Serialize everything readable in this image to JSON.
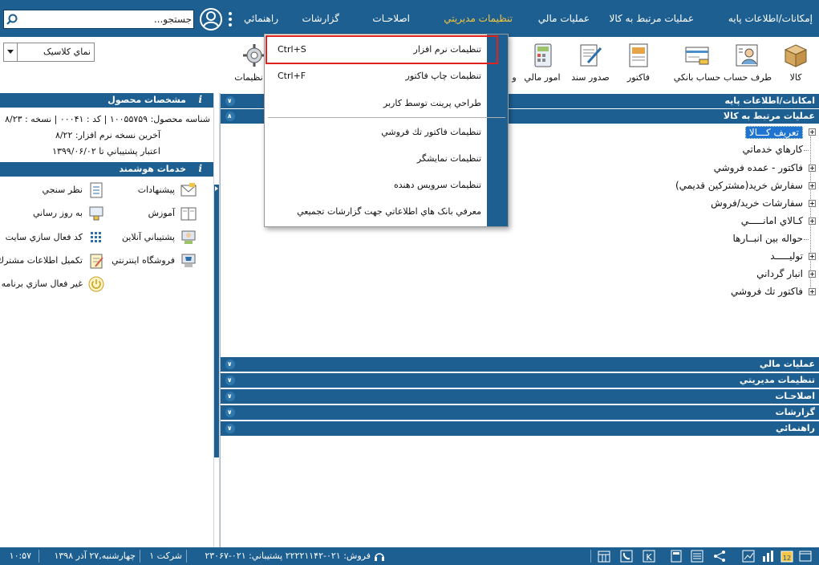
{
  "menu": {
    "items": [
      {
        "label": "إمكانات/اطلاعات پايه"
      },
      {
        "label": "عمليات مرتبط به كالا"
      },
      {
        "label": "عمليات مالي"
      },
      {
        "label": "تنظيمات مديريتي"
      },
      {
        "label": "اصلاحـات"
      },
      {
        "label": "گزارشات"
      },
      {
        "label": "راهنمائي"
      }
    ],
    "active_color": "#f4c542"
  },
  "search": {
    "value": "جستجو..."
  },
  "toolbar": {
    "buttons": [
      {
        "label": "كالا"
      },
      {
        "label": "طرف حساب"
      },
      {
        "label": "حساب بانكي"
      },
      {
        "label": "فاكتور"
      },
      {
        "label": "صدور سند"
      },
      {
        "label": "امور مالي"
      },
      {
        "label": "و"
      },
      {
        "label": "نظيمات"
      }
    ],
    "theme_select": {
      "value": "نماي كلاسيک"
    }
  },
  "product_info": {
    "header": "مشخصات محصول",
    "line1": "شناسه محصول: ۱۰۰۵۵۷۵۹ | كد : ۰۰۰۴۱ | نسخه : ۸/۲۳",
    "line2": "آخرين نسخه نرم افزار: ۸/۲۲",
    "line3": "اعتبار پشتيباني تا ۱۳۹۹/۰۶/۰۲"
  },
  "smart_services": {
    "header": "خدمات هوشمند",
    "items": [
      {
        "label": "پيشنهادات",
        "icon": "envelope-icon"
      },
      {
        "label": "نظر سنجي",
        "icon": "checklist-icon"
      },
      {
        "label": "آموزش",
        "icon": "book-icon"
      },
      {
        "label": "به روز رساني",
        "icon": "update-icon"
      },
      {
        "label": "پشتيباني آنلاين",
        "icon": "support-icon"
      },
      {
        "label": "كد فعال سازي سايت",
        "icon": "keypad-icon"
      },
      {
        "label": "فروشگاه اينترنتي",
        "icon": "shop-icon"
      },
      {
        "label": "تكميل اطلاعات مشترك",
        "icon": "form-icon"
      },
      {
        "label": "غير فعال سازي برنامه",
        "icon": "power-icon"
      }
    ]
  },
  "sections": {
    "top": [
      {
        "title": "امكانات/اطلاعات پايه"
      },
      {
        "title": "عمليات مرتبط به كالا"
      }
    ],
    "bottom": [
      {
        "title": "عمليات مالي"
      },
      {
        "title": "تنظيمات مديريتي"
      },
      {
        "title": "اصلاحـات"
      },
      {
        "title": "گزارشات"
      },
      {
        "title": "راهنمائي"
      }
    ]
  },
  "tree": [
    {
      "label": "تعريف كـــالا",
      "selected": true,
      "expandable": true
    },
    {
      "label": "كارهاي خدماتي",
      "expandable": false
    },
    {
      "label": "فاكتور - عمده فروشي",
      "expandable": true
    },
    {
      "label": "سفارش خريد(مشتركين قديمي)",
      "expandable": true
    },
    {
      "label": "سفارشات خريد/فروش",
      "expandable": true
    },
    {
      "label": "كـالاي امانـــــي",
      "expandable": true
    },
    {
      "label": "حواله بين انبــارها",
      "expandable": false
    },
    {
      "label": "توليـــــد",
      "expandable": true
    },
    {
      "label": "انبار گرداني",
      "expandable": true
    },
    {
      "label": "فاكتور تك فروشي",
      "expandable": true
    }
  ],
  "dropdown": {
    "items": [
      {
        "label": "تنظيمات نرم افزار",
        "shortcut": "Ctrl+S"
      },
      {
        "label": "تنظيمات چاپ فاكتور",
        "shortcut": "Ctrl+F"
      },
      {
        "label": "طراحي پرينت توسط كاربر",
        "shortcut": ""
      },
      {
        "label": "تنظيمات فاكتور تك فروشي",
        "shortcut": ""
      },
      {
        "label": "تنظيمات نمايشگر",
        "shortcut": ""
      },
      {
        "label": "تنظيمات سرويس دهنده",
        "shortcut": ""
      },
      {
        "label": "معرفي بانک هاي اطلاعاتي جهت گزارشات تجميعي",
        "shortcut": ""
      }
    ],
    "highlight_color": "#e0211d"
  },
  "statusbar": {
    "sales": "فروش: ۰۲۱-۲۲۲۲۱۱۴۲  پشتيباني: ۰۲۱-۲۳۰۶۷",
    "company": "شركت ۱",
    "date": "چهارشنبه,۲۷ آذر ۱۳۹۸",
    "time": "۱۰:۵۷"
  },
  "colors": {
    "primary": "#1e5f91",
    "selection": "#1e74d0"
  }
}
